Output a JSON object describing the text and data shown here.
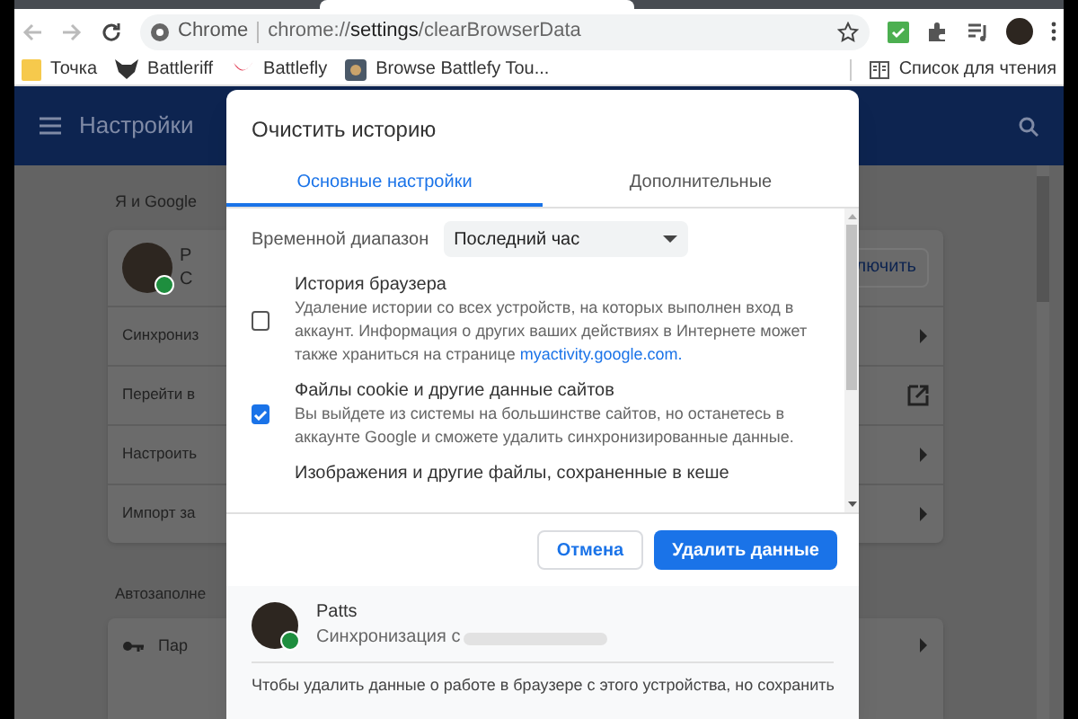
{
  "toolbar": {
    "site_label": "Chrome",
    "url_prefix": "chrome://",
    "url_bold": "settings",
    "url_suffix": "/clearBrowserData"
  },
  "bookmarks": [
    {
      "label": "Точка",
      "kind": "folder"
    },
    {
      "label": "Battleriff",
      "kind": "mask"
    },
    {
      "label": "Battlefly",
      "kind": "wing"
    },
    {
      "label": "Browse Battlefy Tou...",
      "kind": "gear"
    }
  ],
  "reading_list": "Список для чтения",
  "settings": {
    "title": "Настройки",
    "section": "Я и Google",
    "profile_letters": [
      "Р",
      "С"
    ],
    "profile_button": "лючить",
    "rows": [
      {
        "label": "Синхрониз",
        "kind": "arrow"
      },
      {
        "label": "Перейти в",
        "kind": "external"
      },
      {
        "label": "Настроить",
        "kind": "arrow"
      },
      {
        "label": "Импорт за",
        "kind": "arrow"
      }
    ],
    "section2": "Автозаполне",
    "section2_row": "Пар"
  },
  "dialog": {
    "title": "Очистить историю",
    "tabs": [
      {
        "label": "Основные настройки",
        "selected": true
      },
      {
        "label": "Дополнительные",
        "selected": false
      }
    ],
    "time_range": {
      "label": "Временной диапазон",
      "value": "Последний час"
    },
    "items": [
      {
        "title": "История браузера",
        "description": "Удаление истории со всех устройств, на которых выполнен вход в аккаунт. Информация о других ваших действиях в Интернете может также храниться на странице",
        "link": "myactivity.google.com.",
        "checked": false
      },
      {
        "title": "Файлы cookie и другие данные сайтов",
        "description": "Вы выйдете из системы на большинстве сайтов, но останетесь в аккаунте Google и сможете удалить синхронизированные данные.",
        "checked": true
      },
      {
        "title": "Изображения и другие файлы, сохраненные в кеше"
      }
    ],
    "buttons": [
      {
        "label": "Отмена",
        "kind": "secondary"
      },
      {
        "label": "Удалить данные",
        "kind": "primary"
      }
    ],
    "account": {
      "name": "Patts",
      "status": "Синхронизация с"
    },
    "footer_text": "Чтобы удалить данные о работе в браузере с этого устройства, но сохранить"
  }
}
